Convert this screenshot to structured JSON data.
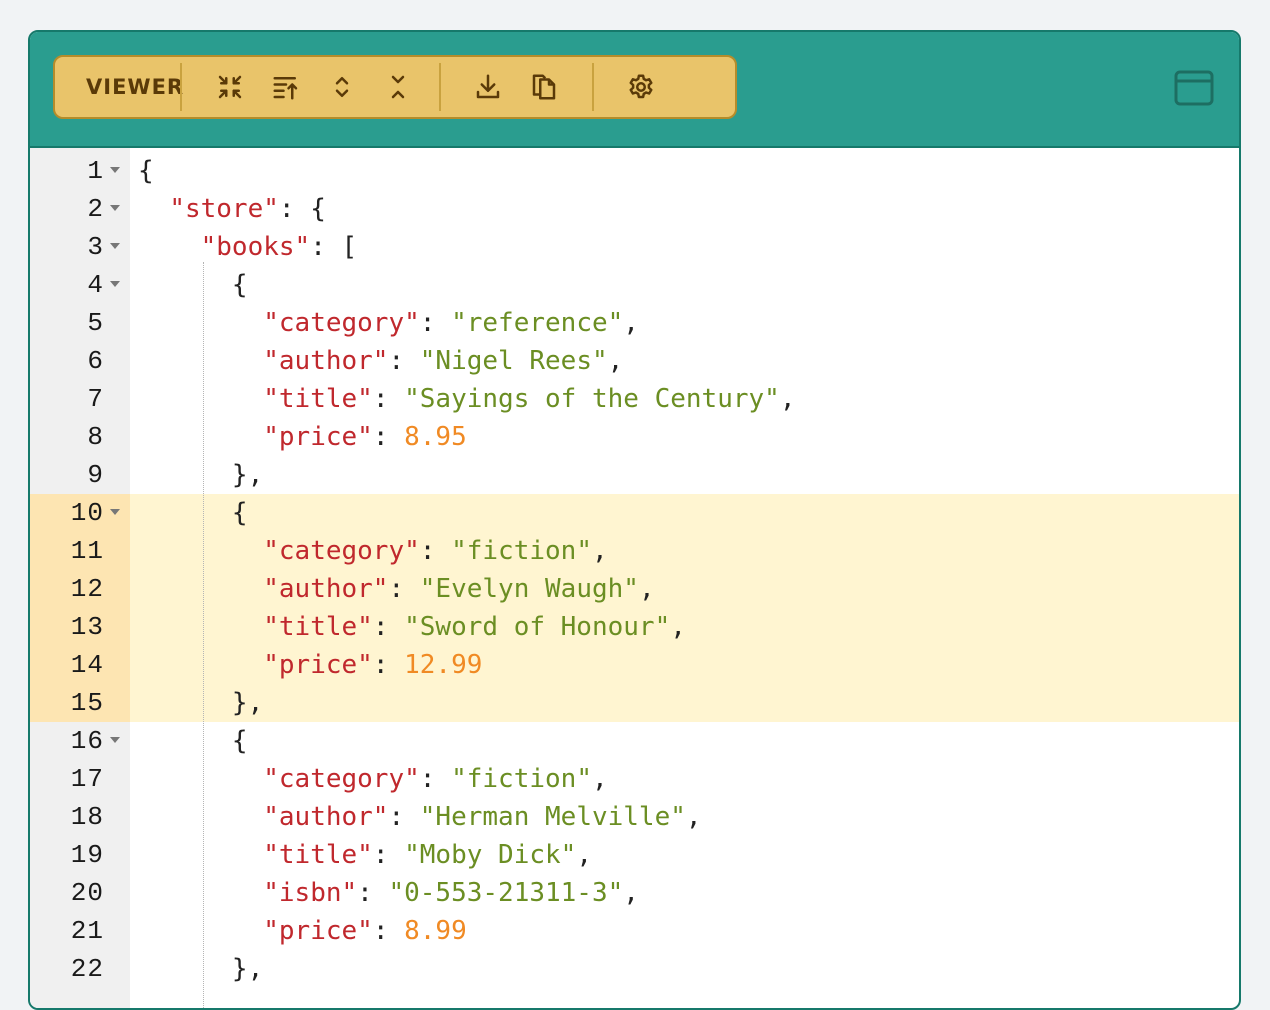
{
  "toolbar": {
    "title": "VIEWER",
    "buttons": [
      {
        "name": "collapse-all",
        "icon": "arrows-inward-icon"
      },
      {
        "name": "sort",
        "icon": "sort-up-icon"
      },
      {
        "name": "expand",
        "icon": "chevron-up-down-icon"
      },
      {
        "name": "collapse",
        "icon": "chevron-down-up-icon"
      },
      {
        "name": "download",
        "icon": "download-icon"
      },
      {
        "name": "copy",
        "icon": "copy-icon"
      },
      {
        "name": "settings",
        "icon": "gear-icon"
      }
    ]
  },
  "window_button": {
    "icon": "window-icon"
  },
  "colors": {
    "header": "#2a9d8f",
    "toolbar": "#e9c46a",
    "key": "#c0282d",
    "string": "#6b8e23",
    "number": "#f08a24",
    "highlight": "#fff5d1"
  },
  "editor": {
    "highlighted_lines": [
      10,
      11,
      12,
      13,
      14,
      15
    ],
    "lines": [
      {
        "n": "1",
        "fold": true,
        "text": "{"
      },
      {
        "n": "2",
        "fold": true,
        "text": "  \"store\": {"
      },
      {
        "n": "3",
        "fold": true,
        "text": "    \"books\": ["
      },
      {
        "n": "4",
        "fold": true,
        "text": "      {"
      },
      {
        "n": "5",
        "fold": false,
        "text": "        \"category\": \"reference\","
      },
      {
        "n": "6",
        "fold": false,
        "text": "        \"author\": \"Nigel Rees\","
      },
      {
        "n": "7",
        "fold": false,
        "text": "        \"title\": \"Sayings of the Century\","
      },
      {
        "n": "8",
        "fold": false,
        "text": "        \"price\": 8.95"
      },
      {
        "n": "9",
        "fold": false,
        "text": "      },"
      },
      {
        "n": "10",
        "fold": true,
        "text": "      {"
      },
      {
        "n": "11",
        "fold": false,
        "text": "        \"category\": \"fiction\","
      },
      {
        "n": "12",
        "fold": false,
        "text": "        \"author\": \"Evelyn Waugh\","
      },
      {
        "n": "13",
        "fold": false,
        "text": "        \"title\": \"Sword of Honour\","
      },
      {
        "n": "14",
        "fold": false,
        "text": "        \"price\": 12.99"
      },
      {
        "n": "15",
        "fold": false,
        "text": "      },"
      },
      {
        "n": "16",
        "fold": true,
        "text": "      {"
      },
      {
        "n": "17",
        "fold": false,
        "text": "        \"category\": \"fiction\","
      },
      {
        "n": "18",
        "fold": false,
        "text": "        \"author\": \"Herman Melville\","
      },
      {
        "n": "19",
        "fold": false,
        "text": "        \"title\": \"Moby Dick\","
      },
      {
        "n": "20",
        "fold": false,
        "text": "        \"isbn\": \"0-553-21311-3\","
      },
      {
        "n": "21",
        "fold": false,
        "text": "        \"price\": 8.99"
      },
      {
        "n": "22",
        "fold": false,
        "text": "      },"
      }
    ]
  }
}
